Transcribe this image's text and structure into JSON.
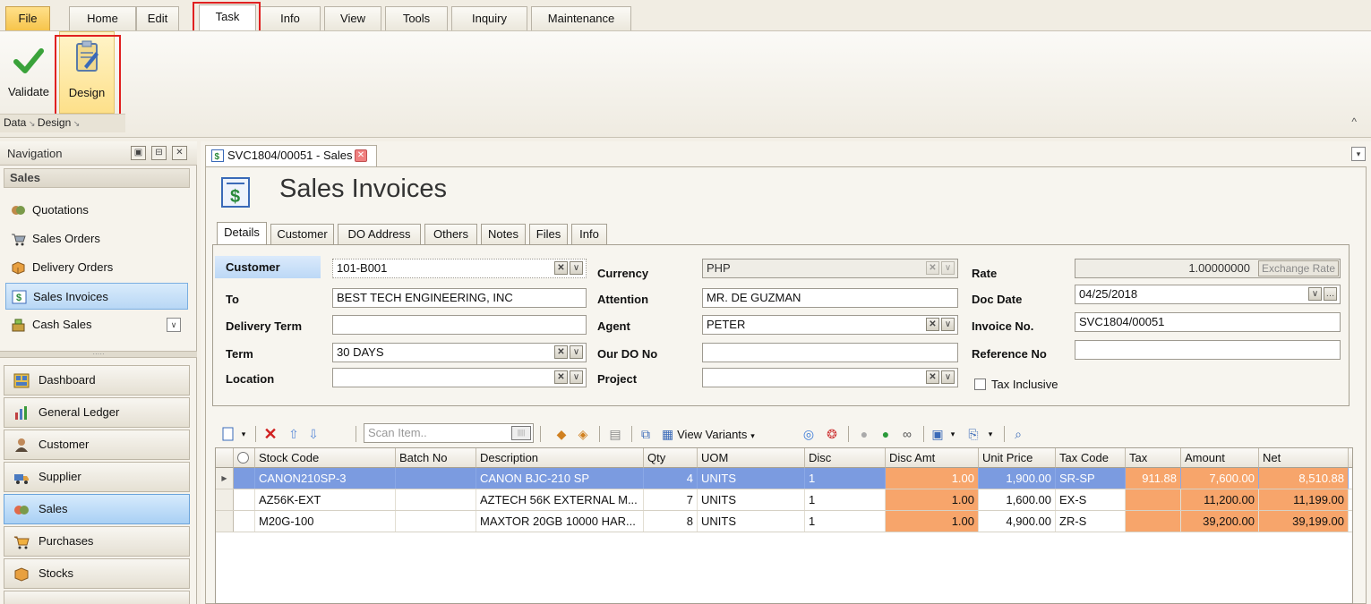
{
  "ribbon": {
    "tabs": [
      {
        "label": "File"
      },
      {
        "label": "Home"
      },
      {
        "label": "Edit"
      },
      {
        "label": "Task"
      },
      {
        "label": "Info"
      },
      {
        "label": "View"
      },
      {
        "label": "Tools"
      },
      {
        "label": "Inquiry"
      },
      {
        "label": "Maintenance"
      }
    ],
    "active_tab": "Task",
    "buttons": {
      "validate": "Validate",
      "design": "Design"
    },
    "groups": {
      "data": "Data",
      "design": "Design"
    }
  },
  "navigation": {
    "title": "Navigation",
    "section": "Sales",
    "items": [
      "Quotations",
      "Sales Orders",
      "Delivery Orders",
      "Sales Invoices",
      "Cash Sales"
    ],
    "selected_item": "Sales Invoices",
    "modules": [
      "Dashboard",
      "General Ledger",
      "Customer",
      "Supplier",
      "Sales",
      "Purchases",
      "Stocks"
    ],
    "selected_module": "Sales"
  },
  "document": {
    "tab_label": "SVC1804/00051 - Sales",
    "title": "Sales Invoices",
    "tabs": [
      "Details",
      "Customer",
      "DO Address",
      "Others",
      "Notes",
      "Files",
      "Info"
    ],
    "active_tab": "Details"
  },
  "form": {
    "customer": {
      "label": "Customer",
      "value": "101-B001"
    },
    "to": {
      "label": "To",
      "value": "BEST TECH ENGINEERING, INC"
    },
    "delivery_term": {
      "label": "Delivery Term",
      "value": ""
    },
    "term": {
      "label": "Term",
      "value": "30 DAYS"
    },
    "location": {
      "label": "Location",
      "value": ""
    },
    "currency": {
      "label": "Currency",
      "value": "PHP"
    },
    "attention": {
      "label": "Attention",
      "value": "MR. DE GUZMAN"
    },
    "agent": {
      "label": "Agent",
      "value": "PETER"
    },
    "our_do_no": {
      "label": "Our DO No",
      "value": ""
    },
    "project": {
      "label": "Project",
      "value": ""
    },
    "rate": {
      "label": "Rate",
      "value": "1.00000000",
      "button": "Exchange Rate"
    },
    "doc_date": {
      "label": "Doc Date",
      "value": "04/25/2018"
    },
    "invoice_no": {
      "label": "Invoice No.",
      "value": "SVC1804/00051"
    },
    "reference_no": {
      "label": "Reference No",
      "value": ""
    },
    "tax_inclusive": {
      "label": "Tax Inclusive",
      "checked": false
    }
  },
  "toolbar": {
    "scan_placeholder": "Scan Item..",
    "view_variants": "View Variants"
  },
  "grid": {
    "columns": [
      "Stock Code",
      "Batch No",
      "Description",
      "Qty",
      "UOM",
      "Disc",
      "Disc Amt",
      "Unit Price",
      "Tax Code",
      "Tax",
      "Amount",
      "Net"
    ],
    "rows": [
      {
        "stock_code": "CANON210SP-3",
        "batch_no": "",
        "description": "CANON BJC-210 SP",
        "qty": "4",
        "uom": "UNITS",
        "disc": "1",
        "disc_amt": "1.00",
        "unit_price": "1,900.00",
        "tax_code": "SR-SP",
        "tax": "911.88",
        "amount": "7,600.00",
        "net": "8,510.88"
      },
      {
        "stock_code": "AZ56K-EXT",
        "batch_no": "",
        "description": "AZTECH 56K EXTERNAL M...",
        "qty": "7",
        "uom": "UNITS",
        "disc": "1",
        "disc_amt": "1.00",
        "unit_price": "1,600.00",
        "tax_code": "EX-S",
        "tax": "",
        "amount": "11,200.00",
        "net": "11,199.00"
      },
      {
        "stock_code": "M20G-100",
        "batch_no": "",
        "description": "MAXTOR 20GB 10000 HAR...",
        "qty": "8",
        "uom": "UNITS",
        "disc": "1",
        "disc_amt": "1.00",
        "unit_price": "4,900.00",
        "tax_code": "ZR-S",
        "tax": "",
        "amount": "39,200.00",
        "net": "39,199.00"
      }
    ]
  },
  "colors": {
    "highlight_box": "#e02020",
    "selection": "#7b9be0",
    "computed_cell": "#f7a56b"
  }
}
